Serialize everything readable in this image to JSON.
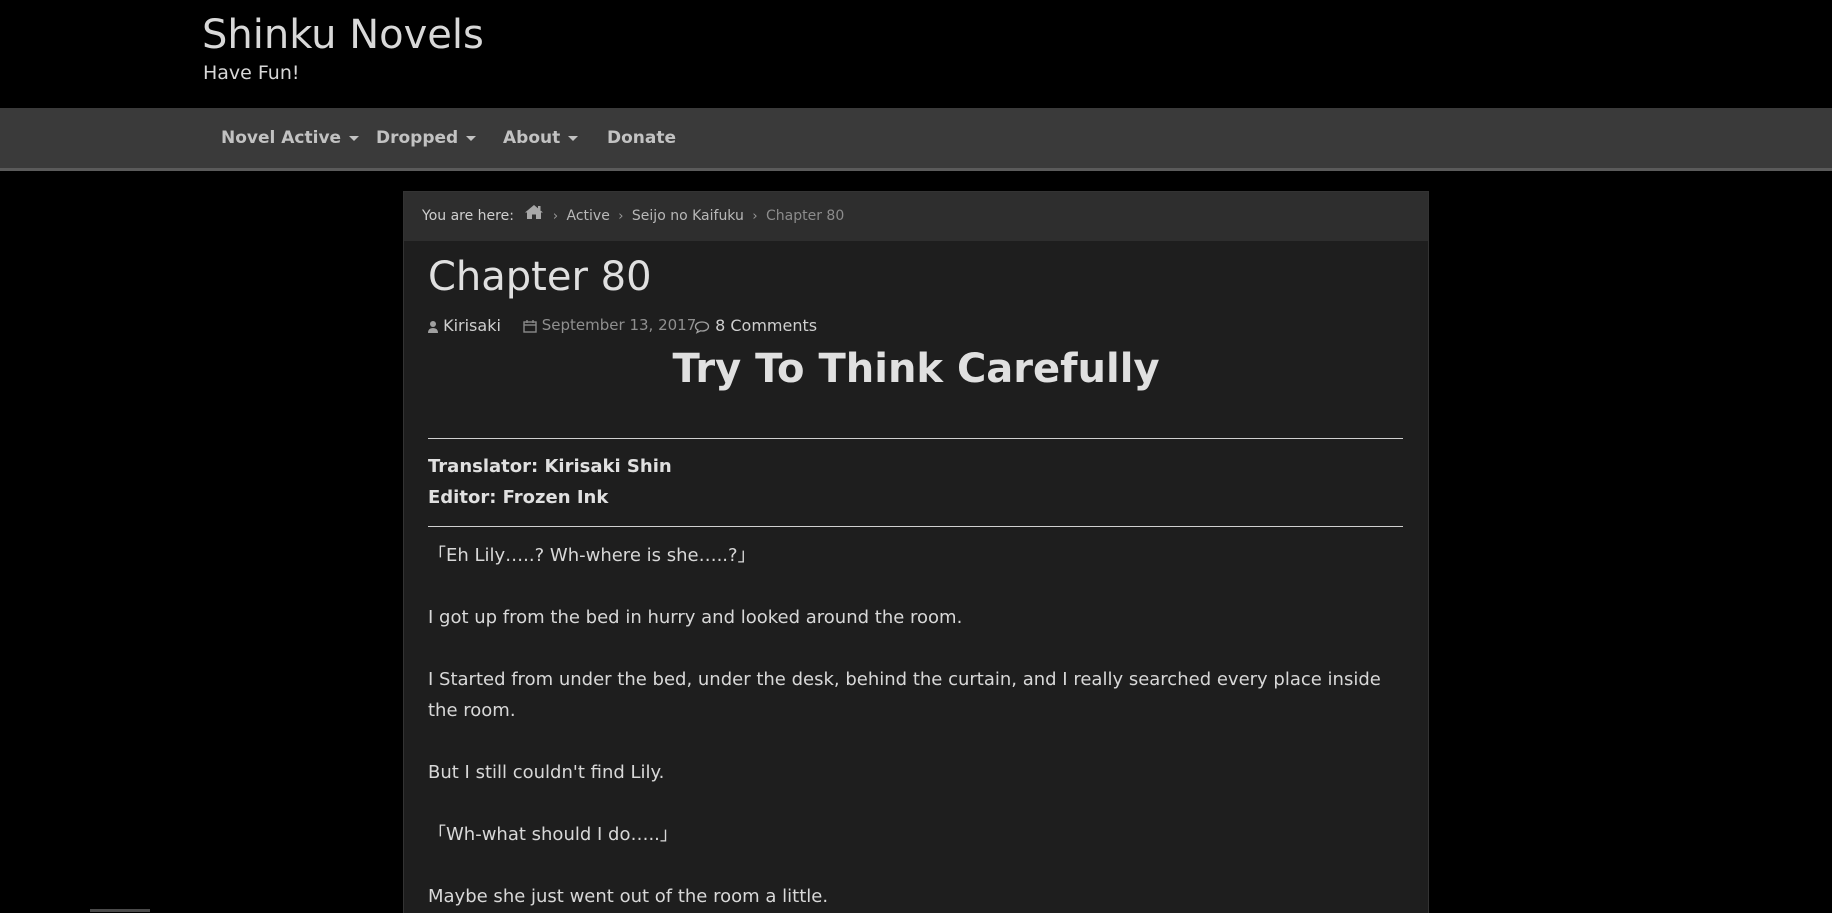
{
  "site": {
    "title": "Shinku Novels",
    "tagline": "Have Fun!"
  },
  "nav": {
    "items": [
      {
        "label": "Novel Active",
        "dropdown": true
      },
      {
        "label": "Dropped",
        "dropdown": true
      },
      {
        "label": "About",
        "dropdown": true
      },
      {
        "label": "Donate",
        "dropdown": false
      }
    ]
  },
  "breadcrumb": {
    "prefix": "You are here:",
    "home_icon": "home-icon",
    "items": [
      "Active",
      "Seijo no Kaifuku"
    ],
    "current": "Chapter 80"
  },
  "post": {
    "title": "Chapter 80",
    "author": "Kirisaki",
    "date": "September 13, 2017",
    "comments": "8 Comments",
    "subtitle": "Try To Think Carefully",
    "translator": "Translator: Kirisaki Shin",
    "editor": "Editor: Frozen Ink",
    "paragraphs": [
      "「Eh Lily…..?  Wh-where is she…..?」",
      "I got up from the bed in hurry and looked around the room.",
      "I Started from under the bed, under the desk, behind the curtain, and I really searched every place inside the room.",
      "But I still couldn't find Lily.",
      "「Wh-what should I do…..」",
      "Maybe she just went out of the room a little."
    ]
  },
  "colors": {
    "page_bg": "#000000",
    "navbar_bg": "#3a3a3a",
    "content_bg": "#1e1e1e",
    "breadcrumb_bg": "#2e2e2e",
    "text": "#d8d8d8"
  }
}
